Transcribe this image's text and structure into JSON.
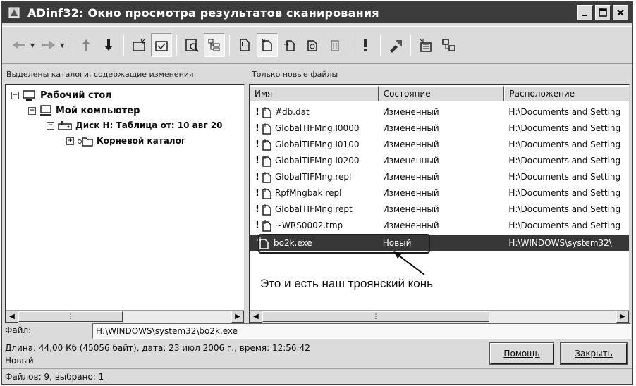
{
  "window": {
    "title": "ADinf32: Окно просмотра результатов сканирования"
  },
  "toolbar": {
    "buttons": [
      {
        "icon": "back-arrow-icon"
      },
      {
        "icon": "forward-arrow-icon"
      },
      {
        "icon": "up-arrow-icon"
      },
      {
        "icon": "down-arrow-icon"
      },
      {
        "icon": "new-catalog-icon"
      },
      {
        "icon": "checked-catalog-icon"
      },
      {
        "icon": "search-folder-icon"
      },
      {
        "icon": "tree-view-icon"
      },
      {
        "icon": "new-file-icon"
      },
      {
        "icon": "changed-file-icon"
      },
      {
        "icon": "moved-file-icon"
      },
      {
        "icon": "renamed-file-icon"
      },
      {
        "icon": "deleted-file-icon"
      },
      {
        "icon": "warning-icon"
      },
      {
        "icon": "tools-icon"
      },
      {
        "icon": "settings-icon"
      },
      {
        "icon": "export-icon"
      }
    ]
  },
  "left_pane": {
    "caption": "Выделены каталоги, содержащие изменения",
    "tree": [
      {
        "label": "Рабочий стол",
        "expander": "−"
      },
      {
        "label": "Мой компьютер",
        "expander": "−"
      },
      {
        "label": "Диск H: Таблица от: 10 авг 20",
        "expander": "−"
      },
      {
        "label": "Корневой каталог",
        "expander": "+"
      }
    ]
  },
  "right_pane": {
    "caption": "Только новые файлы",
    "columns": [
      "Имя",
      "Состояние",
      "Расположение"
    ],
    "rows": [
      {
        "flag": "!",
        "name": "#db.dat",
        "state": "Измененный",
        "location": "H:\\Documents and Setting"
      },
      {
        "flag": "!",
        "name": "GlobalTIFMng.I0000",
        "state": "Измененный",
        "location": "H:\\Documents and Setting"
      },
      {
        "flag": "!",
        "name": "GlobalTIFMng.I0100",
        "state": "Измененный",
        "location": "H:\\Documents and Setting"
      },
      {
        "flag": "!",
        "name": "GlobalTIFMng.I0200",
        "state": "Измененный",
        "location": "H:\\Documents and Setting"
      },
      {
        "flag": "!",
        "name": "GlobalTIFMng.repl",
        "state": "Измененный",
        "location": "H:\\Documents and Setting"
      },
      {
        "flag": "!",
        "name": "RpfMngbak.repl",
        "state": "Измененный",
        "location": "H:\\Documents and Setting"
      },
      {
        "flag": "!",
        "name": "GlobalTIFMng.rept",
        "state": "Измененный",
        "location": "H:\\Documents and Setting"
      },
      {
        "flag": "!",
        "name": "~WRS0002.tmp",
        "state": "Измененный",
        "location": "H:\\Documents and Setting"
      },
      {
        "flag": "",
        "name": "bo2k.exe",
        "state": "Новый",
        "location": "H:\\WINDOWS\\system32\\"
      }
    ],
    "annotation": "Это и есть наш троянский конь"
  },
  "details": {
    "file_label": "Файл:",
    "file_value": "H:\\WINDOWS\\system32\\bo2k.exe",
    "info_line": "Длина: 44,00 Кб  (45056 байт),  дата: 23 июл 2006 г.,  время: 12:56:42",
    "state_line": "Новый"
  },
  "buttons": {
    "help": "Помощь",
    "close": "Закрыть"
  },
  "status": {
    "text": "Файлов: 9, выбрано: 1"
  }
}
